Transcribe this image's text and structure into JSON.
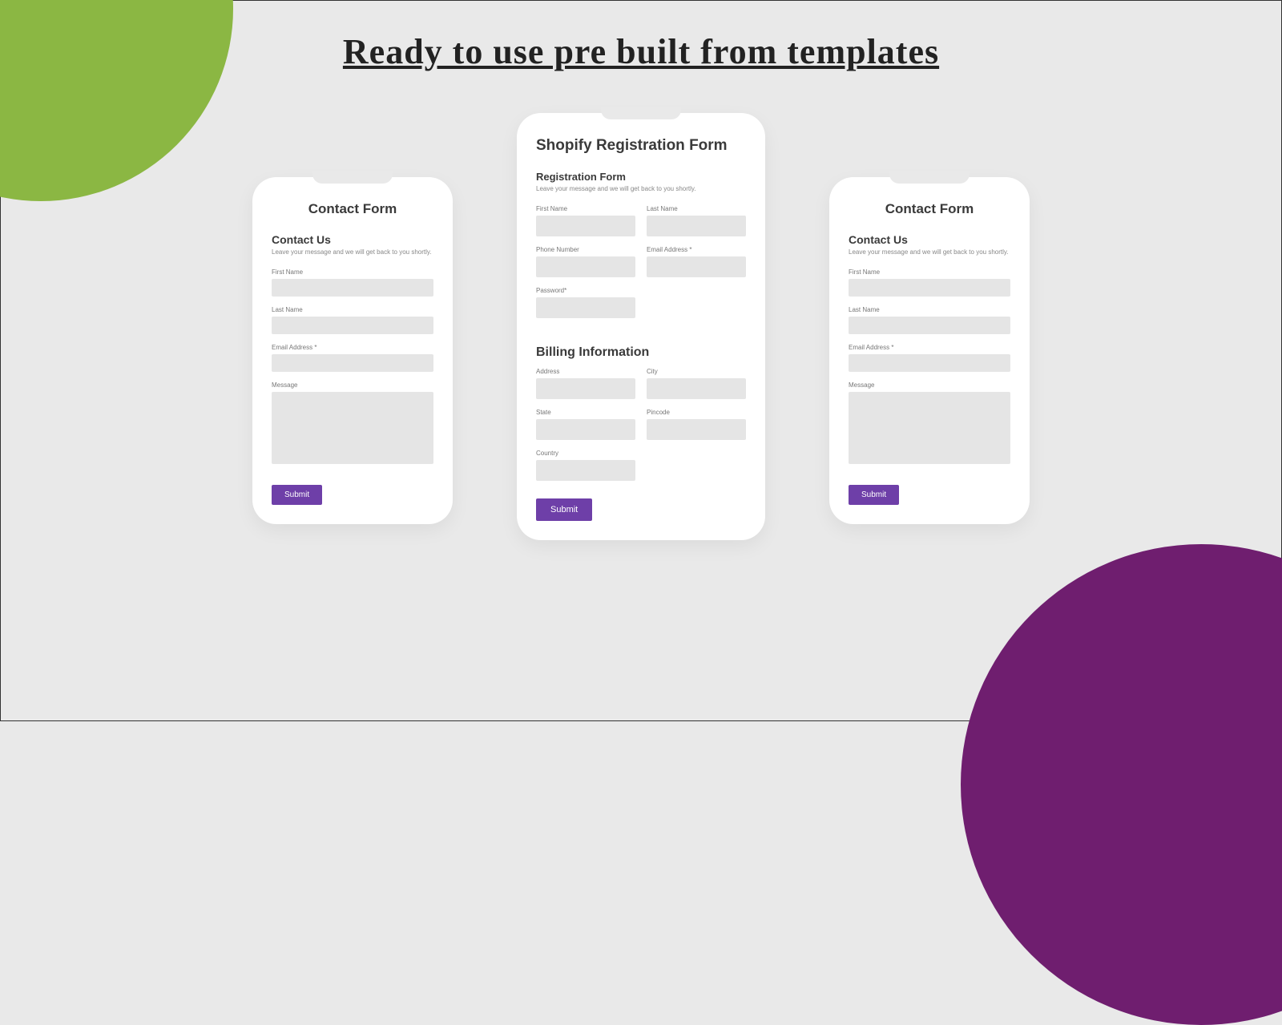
{
  "page_title": "Ready to use pre built  from templates",
  "contact_form": {
    "title": "Contact Form",
    "heading": "Contact Us",
    "sub": "Leave your message and we will get back to you shortly.",
    "fields": {
      "first_name": "First Name",
      "last_name": "Last Name",
      "email": "Email Address *",
      "message": "Message"
    },
    "submit": "Submit"
  },
  "registration_form": {
    "title": "Shopify Registration Form",
    "section1_heading": "Registration Form",
    "sub": "Leave your message and we will get back to you shortly.",
    "fields": {
      "first_name": "First Name",
      "last_name": "Last Name",
      "phone": "Phone Number",
      "email": "Email Address *",
      "password": "Password*"
    },
    "section2_heading": "Billing Information",
    "billing": {
      "address": "Address",
      "city": "City",
      "state": "State",
      "pincode": "Pincode",
      "country": "Country"
    },
    "submit": "Submit"
  }
}
